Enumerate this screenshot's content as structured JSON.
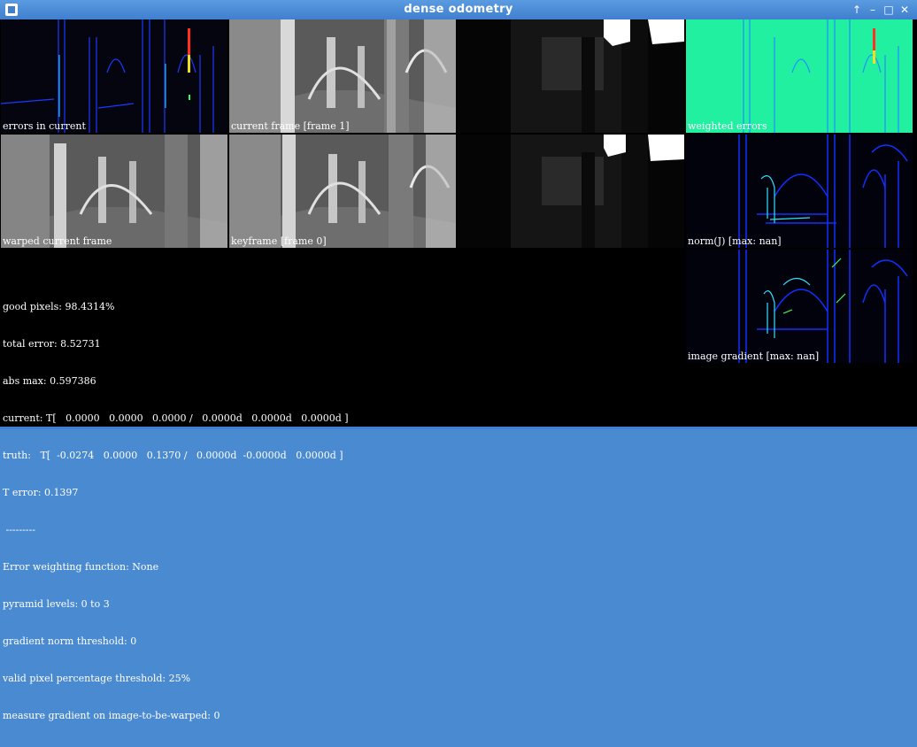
{
  "window": {
    "title": "dense odometry",
    "controls": [
      "up-arrow",
      "minimize",
      "maximize",
      "close"
    ]
  },
  "panels": {
    "errors_in_current": "errors in current",
    "current_frame": "current frame [frame 1]",
    "depth_current": "",
    "weighted_errors": "weighted errors",
    "warped_current_frame": "warped current frame",
    "keyframe": "keyframe [frame 0]",
    "depth_keyframe": "",
    "norm_j": "norm(J) [max: nan]",
    "image_gradient": "image gradient [max: nan]"
  },
  "info": {
    "good_pixels": "good pixels: 98.4314%",
    "total_error": "total error: 8.52731",
    "abs_max": "abs max: 0.597386",
    "current": "current: T[   0.0000   0.0000   0.0000 /   0.0000d   0.0000d   0.0000d ]",
    "truth": "truth:   T[  -0.0274   0.0000   0.1370 /   0.0000d  -0.0000d   0.0000d ]",
    "t_error": "T error: 0.1397",
    "separator": " ---------",
    "error_weighting": "Error weighting function: None",
    "pyramid_levels": "pyramid levels: 0 to 3",
    "gradient_norm_threshold": "gradient norm threshold: 0",
    "valid_pixel_threshold": "valid pixel percentage threshold: 25%",
    "measure_gradient": "measure gradient on image-to-be-warped: 0"
  },
  "colors": {
    "titlebar": "#4a8ad0",
    "selection": "#e020e0",
    "weighted_bg": "#20f0a0"
  }
}
